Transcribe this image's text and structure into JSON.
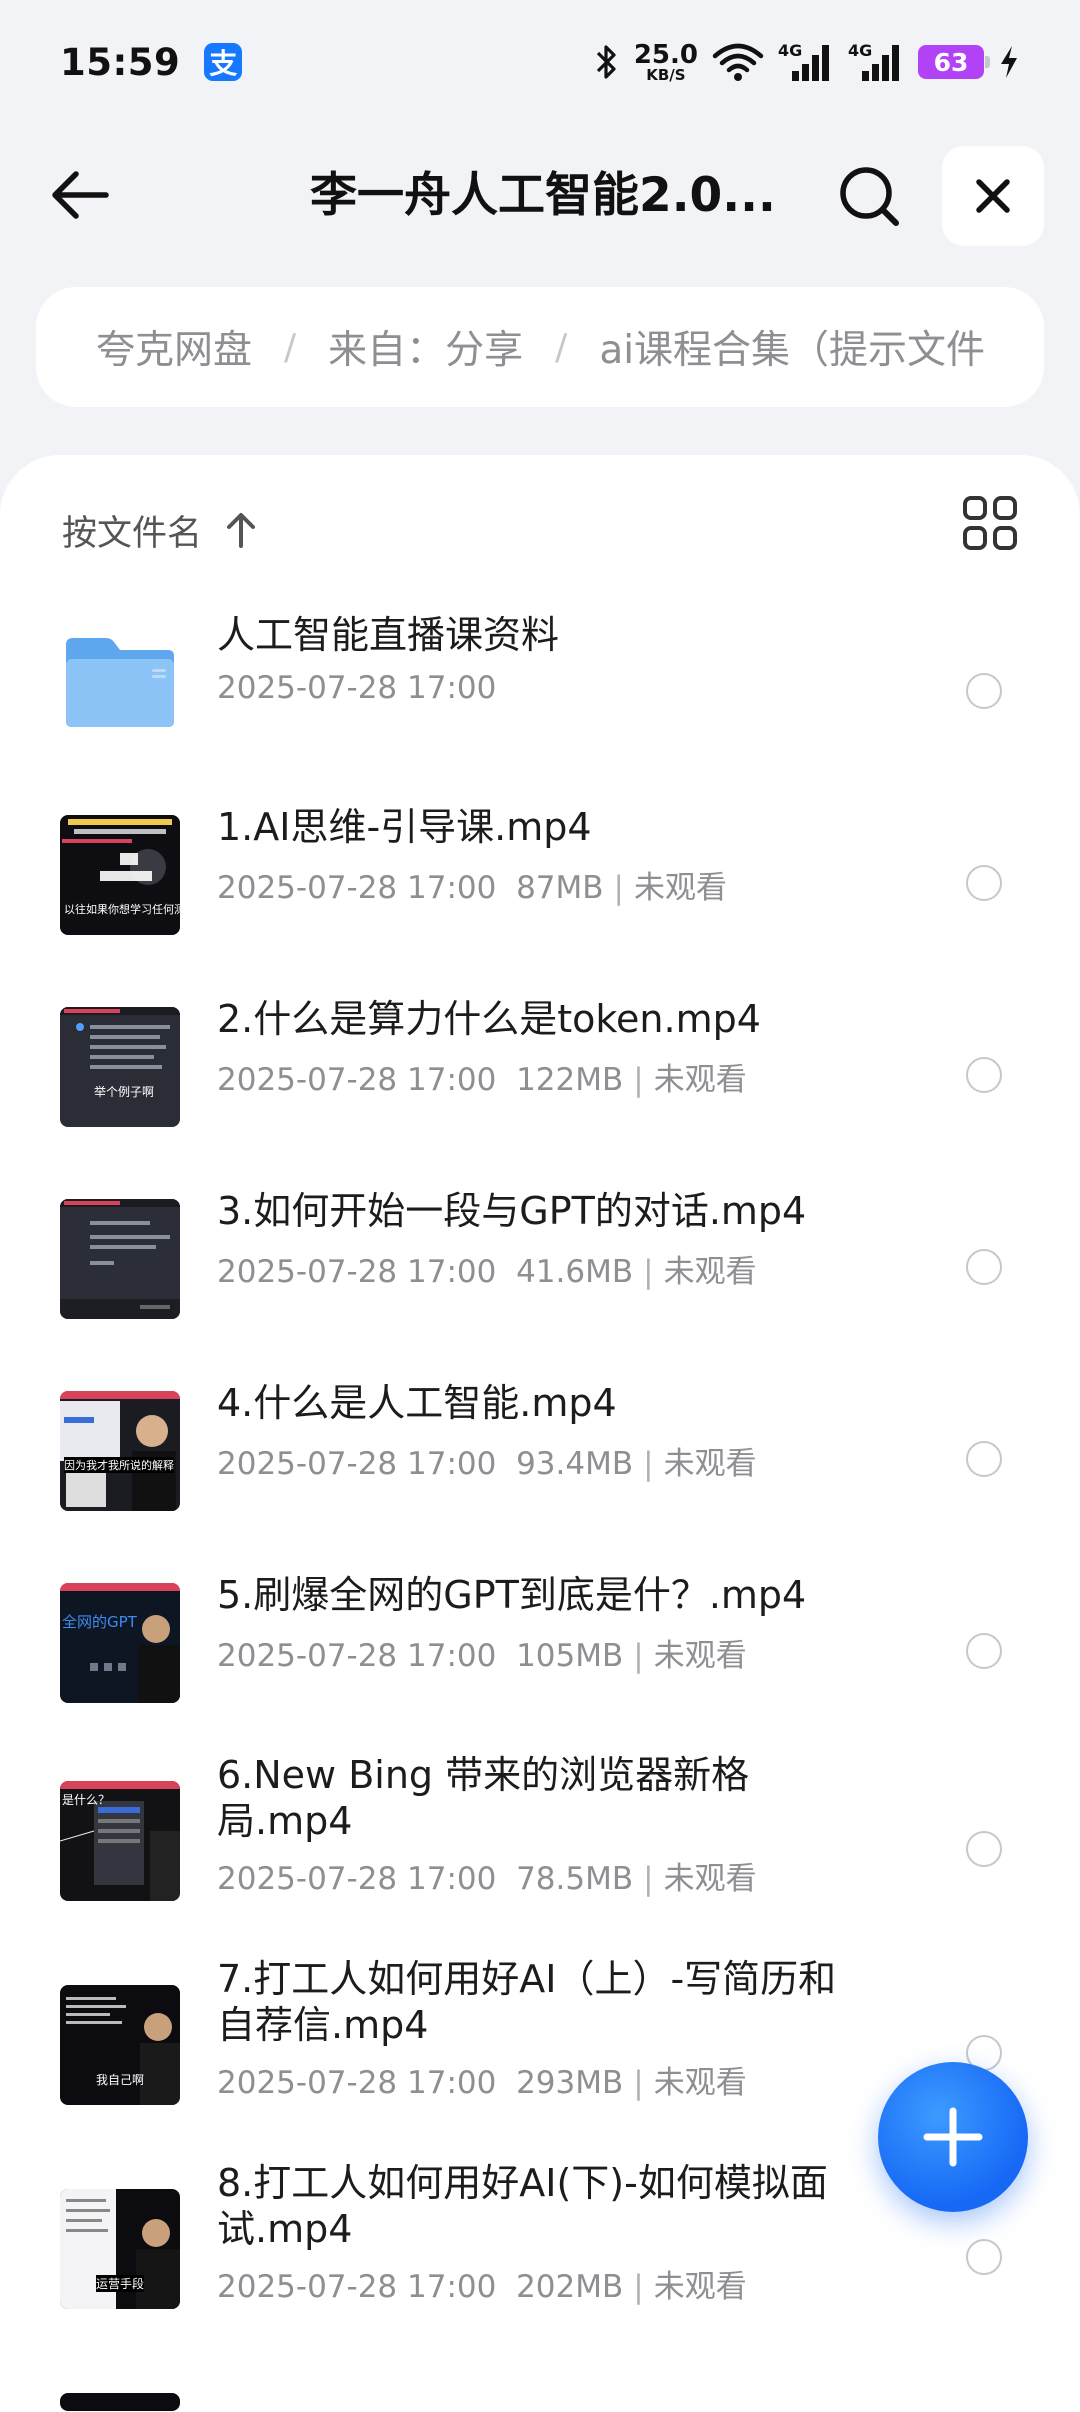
{
  "status_bar": {
    "time": "15:59",
    "alipay_badge": "支",
    "net_speed_value": "25.0",
    "net_speed_unit": "KB/S",
    "signal1_label": "4G",
    "signal2_label": "4G",
    "battery": "63",
    "icons": [
      "bluetooth-icon",
      "wifi-icon",
      "signal-icon",
      "signal-icon",
      "battery-icon",
      "charging-icon"
    ]
  },
  "header": {
    "title": "李一舟人工智能2.0...",
    "icons": [
      "back-arrow-icon",
      "search-icon",
      "close-icon"
    ]
  },
  "breadcrumb": {
    "items": [
      "夸克网盘",
      "来自：分享",
      "ai课程合集（提示文件"
    ],
    "separator": "/"
  },
  "sort": {
    "label": "按文件名",
    "direction_icon": "arrow-up-icon",
    "view_toggle_icon": "grid-view-icon"
  },
  "files": [
    {
      "name": "人工智能直播课资料",
      "date": "2025-07-28 17:00",
      "size": "",
      "status": "",
      "type": "folder",
      "thumb_caption": ""
    },
    {
      "name": "1.AI思维-引导课.mp4",
      "date": "2025-07-28 17:00",
      "size": "87MB",
      "status": "未观看",
      "type": "video",
      "thumb_caption": "以往如果你想学习任何测"
    },
    {
      "name": "2.什么是算力什么是token.mp4",
      "date": "2025-07-28 17:00",
      "size": "122MB",
      "status": "未观看",
      "type": "video",
      "thumb_caption": "举个例子啊"
    },
    {
      "name": "3.如何开始一段与GPT的对话.mp4",
      "date": "2025-07-28 17:00",
      "size": "41.6MB",
      "status": "未观看",
      "type": "video",
      "thumb_caption": ""
    },
    {
      "name": "4.什么是人工智能.mp4",
      "date": "2025-07-28 17:00",
      "size": "93.4MB",
      "status": "未观看",
      "type": "video",
      "thumb_caption": "因为我才我所说的解释"
    },
    {
      "name": "5.刷爆全网的GPT到底是什？.mp4",
      "date": "2025-07-28 17:00",
      "size": "105MB",
      "status": "未观看",
      "type": "video",
      "thumb_caption": "全网的GPT"
    },
    {
      "name": "6.New Bing 带来的浏览器新格局.mp4",
      "date": "2025-07-28 17:00",
      "size": "78.5MB",
      "status": "未观看",
      "type": "video",
      "thumb_caption": "是什么？"
    },
    {
      "name": "7.打工人如何用好AI（上）-写简历和自荐信.mp4",
      "date": "2025-07-28 17:00",
      "size": "293MB",
      "status": "未观看",
      "type": "video",
      "thumb_caption": "我自己啊"
    },
    {
      "name": "8.打工人如何用好AI(下)-如何模拟面试.mp4",
      "date": "2025-07-28 17:00",
      "size": "202MB",
      "status": "未观看",
      "type": "video",
      "thumb_caption": "运营手段"
    }
  ],
  "fab": {
    "icon": "plus-icon"
  },
  "colors": {
    "accent": "#1668f5",
    "background": "#f2f3f6",
    "battery": "#b142f5",
    "folder": "#7ab8f5"
  }
}
